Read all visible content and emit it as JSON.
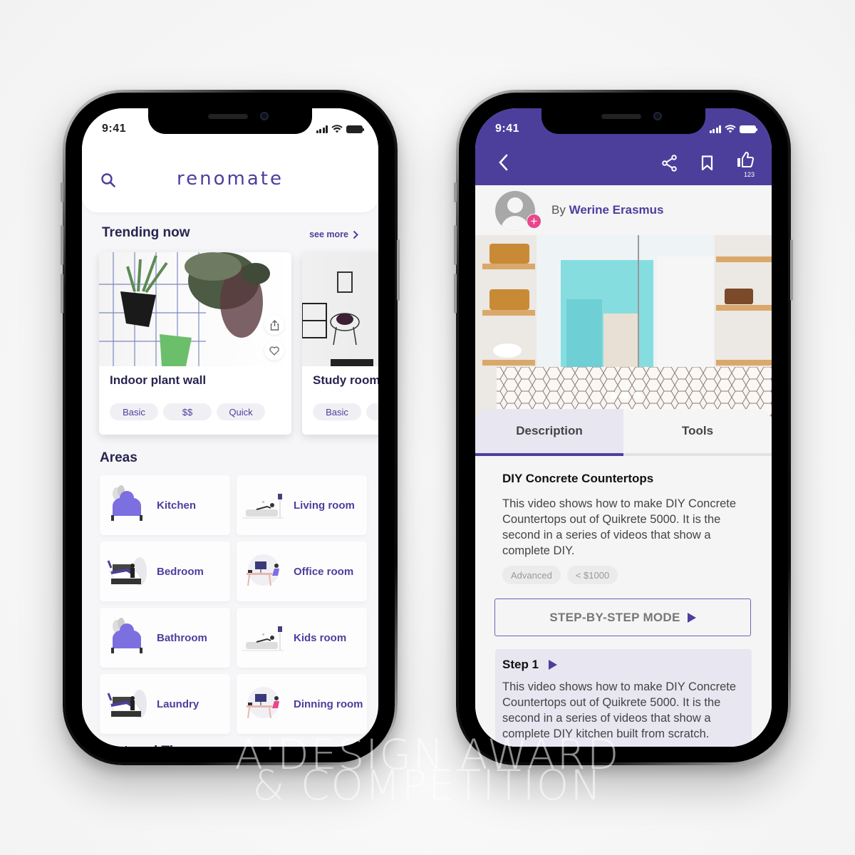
{
  "left_phone": {
    "status_bar": {
      "time": "9:41"
    },
    "header": {
      "logo": "renomate",
      "search_icon": "search-icon"
    },
    "trending": {
      "title": "Trending now",
      "see_more": "see more",
      "cards": [
        {
          "title": "Indoor plant wall",
          "tags": [
            "Basic",
            "$$",
            "Quick"
          ]
        },
        {
          "title": "Study room",
          "tags": [
            "Basic",
            ""
          ]
        }
      ]
    },
    "areas": {
      "title": "Areas",
      "items": [
        {
          "label": "Kitchen",
          "icon": "chef-hat-illustration"
        },
        {
          "label": "Living room",
          "icon": "sofa-person-illustration"
        },
        {
          "label": "Bedroom",
          "icon": "bed-person-illustration"
        },
        {
          "label": "Office room",
          "icon": "desk-person-illustration"
        },
        {
          "label": "Bathroom",
          "icon": "chef-hat-illustration"
        },
        {
          "label": "Kids room",
          "icon": "sofa-person-illustration"
        },
        {
          "label": "Laundry",
          "icon": "bed-person-illustration"
        },
        {
          "label": "Dinning room",
          "icon": "desk-person-illustration"
        }
      ]
    },
    "featured": {
      "title": "Featured Tips"
    }
  },
  "right_phone": {
    "status_bar": {
      "time": "9:41"
    },
    "header": {
      "like_count": "123"
    },
    "author": {
      "prefix": "By",
      "name": "Werine Erasmus"
    },
    "carousel": {
      "slides": 3,
      "active": 3
    },
    "tabs": [
      {
        "label": "Description",
        "active": true
      },
      {
        "label": "Tools",
        "active": false
      }
    ],
    "description": {
      "title": "DIY Concrete Countertops",
      "body": "This video shows how to make DIY Concrete Countertops out of Quikrete 5000. It is the second in a series of videos that show a complete DIY.",
      "tags": [
        "Advanced",
        "< $1000"
      ]
    },
    "step_mode_button": "STEP-BY-STEP MODE",
    "step": {
      "title": "Step 1",
      "body": "This video shows how to make DIY Concrete Countertops out of Quikrete 5000. It is the second in a series of videos that show a complete DIY kitchen built from scratch."
    }
  },
  "watermark": {
    "line1": "A'DESIGN AWARD",
    "line2": "& COMPETITION"
  },
  "colors": {
    "brand": "#4c3f9c",
    "accent_pink": "#e8478b",
    "title_dark": "#272450"
  }
}
